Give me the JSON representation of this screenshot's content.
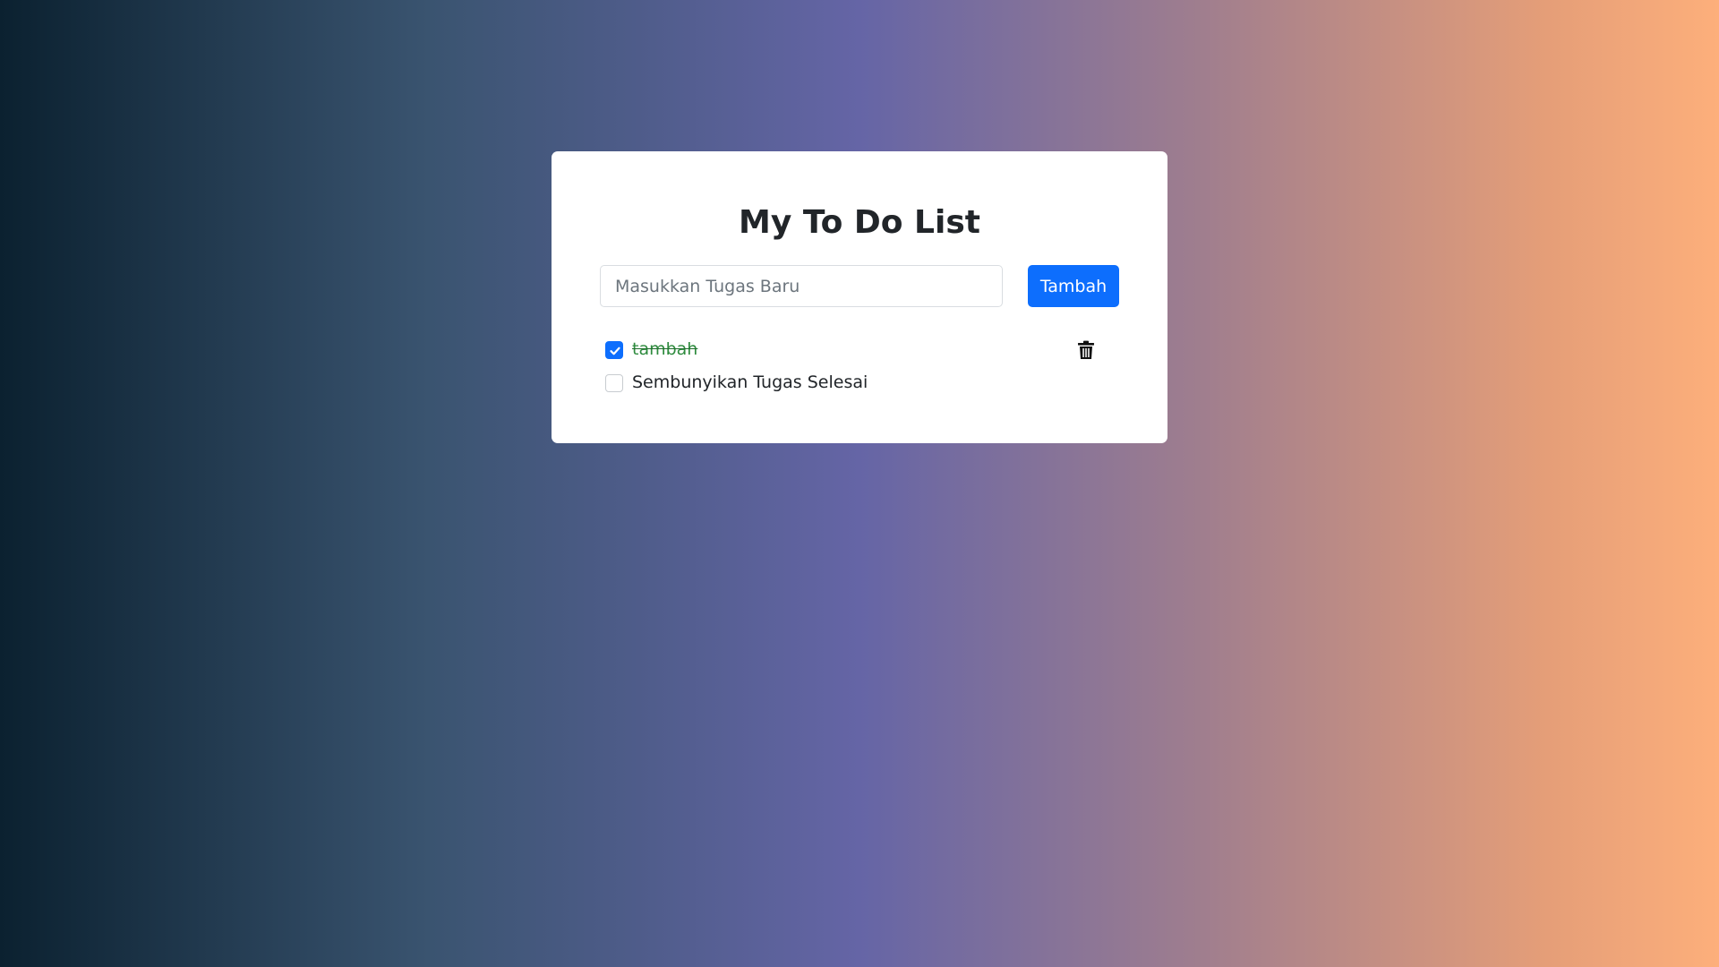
{
  "app": {
    "title": "My To Do List"
  },
  "form": {
    "input_placeholder": "Masukkan Tugas Baru",
    "input_value": "",
    "add_label": "Tambah"
  },
  "tasks": [
    {
      "text": "tambah",
      "done": true
    }
  ],
  "filter": {
    "hide_completed_label": "Sembunyikan Tugas Selesai",
    "hide_completed_checked": false
  },
  "colors": {
    "accent": "#0d6efd",
    "done_text": "#2e8b3e",
    "background_start": "#0b2130",
    "background_mid": "#6565a6",
    "background_end": "#fdaf7b"
  },
  "icons": {
    "check": "check-icon",
    "delete": "trash-icon"
  }
}
